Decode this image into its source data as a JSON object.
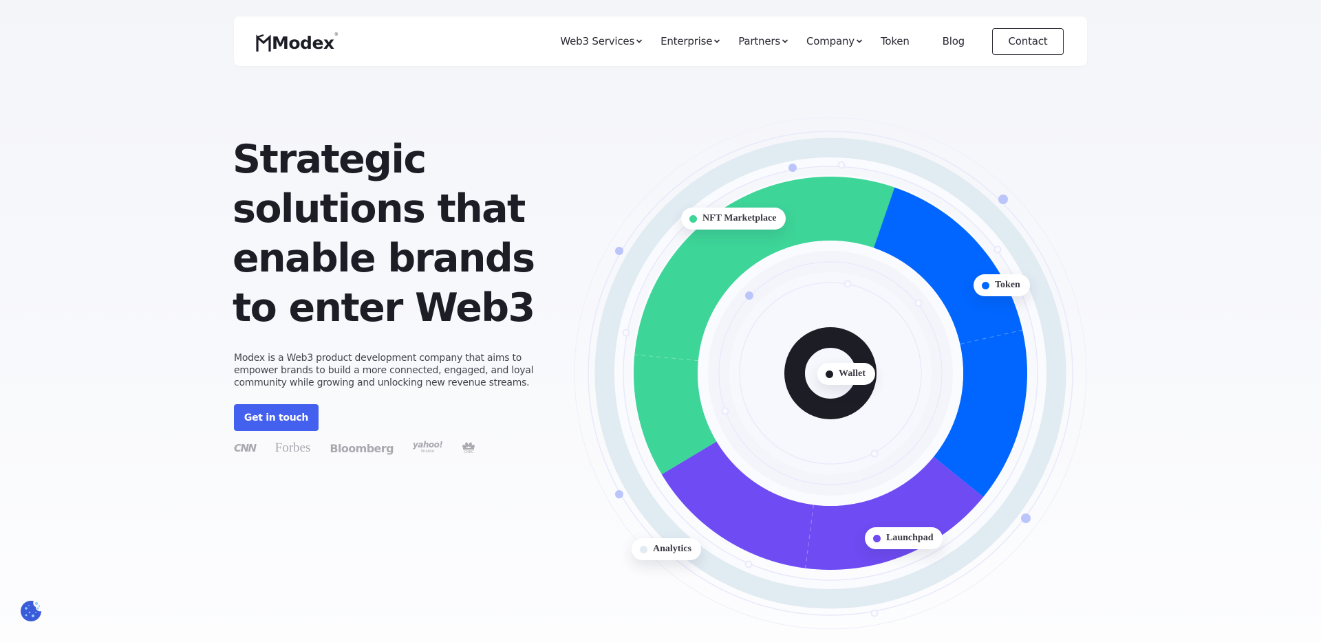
{
  "brand": {
    "name": "Modex",
    "reg_mark": "®"
  },
  "nav": {
    "items": [
      {
        "label": "Web3 Services",
        "has_dropdown": true
      },
      {
        "label": "Enterprise",
        "has_dropdown": true
      },
      {
        "label": "Partners",
        "has_dropdown": true
      },
      {
        "label": "Company",
        "has_dropdown": true
      },
      {
        "label": "Token",
        "has_dropdown": false
      },
      {
        "label": "Blog",
        "has_dropdown": false
      }
    ],
    "contact_label": "Contact"
  },
  "hero": {
    "headline_lines": [
      "Strategic",
      "solutions that",
      "enable brands",
      "to enter Web3"
    ],
    "description": "Modex is a Web3 product development company that aims to empower brands to build a more connected, engaged, and loyal community while growing and unlocking new revenue streams.",
    "cta_label": "Get in touch",
    "press": {
      "cnn": "CNN",
      "forbes": "Forbes",
      "bloomberg": "Bloomberg",
      "yahoo": "yahoo!",
      "yahoo_sub": "finance",
      "cnbc_sub": "CNBC"
    }
  },
  "wheel": {
    "segments": [
      {
        "name": "Token",
        "color": "#0066ff",
        "share": 0.3056
      },
      {
        "name": "Launchpad",
        "color": "#6e4bf2",
        "share": 0.3056
      },
      {
        "name": "NFT Marketplace",
        "color": "#3dd598",
        "share": 0.3889
      }
    ],
    "labels": {
      "nft": {
        "text": "NFT Marketplace",
        "color": "#3dd598"
      },
      "token": {
        "text": "Token",
        "color": "#0066ff"
      },
      "wallet": {
        "text": "Wallet",
        "color": "#1d1d26"
      },
      "launchpad": {
        "text": "Launchpad",
        "color": "#6e4bf2"
      },
      "analytics": {
        "text": "Analytics",
        "color": "#e1ebf2"
      }
    },
    "colors": {
      "ring_band": "#e1ebf2",
      "orbit_line": "#e8e9fb",
      "orbit_dot": "#bcc5fb",
      "center_ring": "#1d1d26"
    }
  },
  "cookie": {
    "icon": "cookie-icon"
  }
}
